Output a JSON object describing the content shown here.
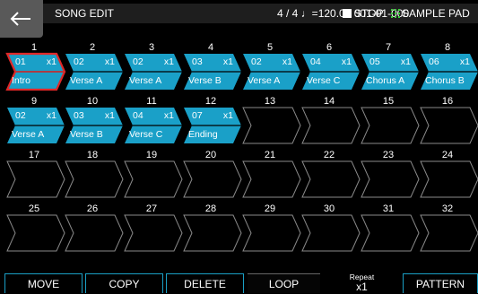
{
  "header": {
    "title": "SONG EDIT",
    "meter": "4 / 4 ♩=120.00  001-01-000",
    "status": "STOP",
    "mode": "SAMPLE PAD"
  },
  "steps": [
    {
      "num": "1",
      "pattern": "01",
      "repeat": "x1",
      "name": "Intro",
      "selected": true
    },
    {
      "num": "2",
      "pattern": "02",
      "repeat": "x1",
      "name": "Verse A"
    },
    {
      "num": "3",
      "pattern": "02",
      "repeat": "x1",
      "name": "Verse A"
    },
    {
      "num": "4",
      "pattern": "03",
      "repeat": "x1",
      "name": "Verse B"
    },
    {
      "num": "5",
      "pattern": "02",
      "repeat": "x1",
      "name": "Verse A"
    },
    {
      "num": "6",
      "pattern": "04",
      "repeat": "x1",
      "name": "Verse C"
    },
    {
      "num": "7",
      "pattern": "05",
      "repeat": "x1",
      "name": "Chorus A"
    },
    {
      "num": "8",
      "pattern": "06",
      "repeat": "x1",
      "name": "Chorus B"
    },
    {
      "num": "9",
      "pattern": "02",
      "repeat": "x1",
      "name": "Verse A"
    },
    {
      "num": "10",
      "pattern": "03",
      "repeat": "x1",
      "name": "Verse B"
    },
    {
      "num": "11",
      "pattern": "04",
      "repeat": "x1",
      "name": "Verse C"
    },
    {
      "num": "12",
      "pattern": "07",
      "repeat": "x1",
      "name": "Ending"
    },
    {
      "num": "13"
    },
    {
      "num": "14"
    },
    {
      "num": "15"
    },
    {
      "num": "16"
    },
    {
      "num": "17"
    },
    {
      "num": "18"
    },
    {
      "num": "19"
    },
    {
      "num": "20"
    },
    {
      "num": "21"
    },
    {
      "num": "22"
    },
    {
      "num": "23"
    },
    {
      "num": "24"
    },
    {
      "num": "25"
    },
    {
      "num": "26"
    },
    {
      "num": "27"
    },
    {
      "num": "28"
    },
    {
      "num": "29"
    },
    {
      "num": "30"
    },
    {
      "num": "31"
    },
    {
      "num": "32"
    }
  ],
  "toolbar": {
    "move": "MOVE",
    "copy": "COPY",
    "delete": "DELETE",
    "loop": "LOOP",
    "repeat_label": "Repeat",
    "repeat_value": "x1",
    "pattern": "PATTERN"
  },
  "colors": {
    "step_fill": "#1aa0c8",
    "selected_outline": "#e02828",
    "empty_outline": "#8a8a8a",
    "button_border": "#1a9fc5"
  },
  "icons": {
    "back": "arrow-left-icon",
    "status": "stop-square-icon",
    "mode": "grid-pad-icon"
  }
}
